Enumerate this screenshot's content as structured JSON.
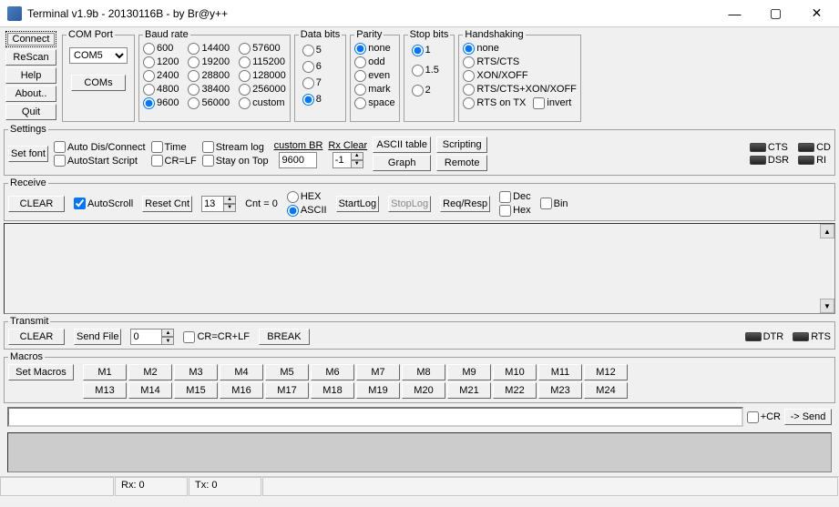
{
  "window": {
    "title": "Terminal v1.9b - 20130116B - by Br@y++"
  },
  "leftButtons": {
    "connect": "Connect",
    "rescan": "ReScan",
    "help": "Help",
    "about": "About..",
    "quit": "Quit"
  },
  "comPort": {
    "legend": "COM Port",
    "selected": "COM5",
    "btn": "COMs"
  },
  "baud": {
    "legend": "Baud rate",
    "options": [
      "600",
      "1200",
      "2400",
      "4800",
      "9600",
      "14400",
      "19200",
      "28800",
      "38400",
      "56000",
      "57600",
      "115200",
      "128000",
      "256000",
      "custom"
    ],
    "selected": "9600"
  },
  "dataBits": {
    "legend": "Data bits",
    "options": [
      "5",
      "6",
      "7",
      "8"
    ],
    "selected": "8"
  },
  "parity": {
    "legend": "Parity",
    "options": [
      "none",
      "odd",
      "even",
      "mark",
      "space"
    ],
    "selected": "none"
  },
  "stopBits": {
    "legend": "Stop bits",
    "options": [
      "1",
      "1.5",
      "2"
    ],
    "selected": "1"
  },
  "handshaking": {
    "legend": "Handshaking",
    "options": [
      "none",
      "RTS/CTS",
      "XON/XOFF",
      "RTS/CTS+XON/XOFF",
      "RTS on TX"
    ],
    "selected": "none",
    "invert": "invert"
  },
  "settings": {
    "legend": "Settings",
    "setFont": "Set font",
    "autoDisConnect": "Auto Dis/Connect",
    "autoStartScript": "AutoStart Script",
    "time": "Time",
    "crlf": "CR=LF",
    "streamLog": "Stream log",
    "stayOnTop": "Stay on Top",
    "customBR": "custom BR",
    "customBRVal": "9600",
    "neg1": "-1",
    "rxClear": "Rx Clear",
    "asciiTable": "ASCII table",
    "graph": "Graph",
    "scripting": "Scripting",
    "remote": "Remote",
    "leds": {
      "cts": "CTS",
      "cd": "CD",
      "dsr": "DSR",
      "ri": "RI"
    }
  },
  "receive": {
    "legend": "Receive",
    "clear": "CLEAR",
    "autoScroll": "AutoScroll",
    "resetCnt": "Reset Cnt",
    "cntVal": "13",
    "cntEq": "Cnt = ",
    "cntNum": "0",
    "hex": "HEX",
    "ascii": "ASCII",
    "startLog": "StartLog",
    "stopLog": "StopLog",
    "reqResp": "Req/Resp",
    "dec": "Dec",
    "hexChk": "Hex",
    "bin": "Bin"
  },
  "transmit": {
    "legend": "Transmit",
    "clear": "CLEAR",
    "sendFile": "Send File",
    "numVal": "0",
    "crcrlf": "CR=CR+LF",
    "break": "BREAK",
    "dtr": "DTR",
    "rts": "RTS"
  },
  "macros": {
    "legend": "Macros",
    "setMacros": "Set Macros",
    "items": [
      "M1",
      "M2",
      "M3",
      "M4",
      "M5",
      "M6",
      "M7",
      "M8",
      "M9",
      "M10",
      "M11",
      "M12",
      "M13",
      "M14",
      "M15",
      "M16",
      "M17",
      "M18",
      "M19",
      "M20",
      "M21",
      "M22",
      "M23",
      "M24"
    ]
  },
  "send": {
    "cr": "+CR",
    "send": "-> Send"
  },
  "status": {
    "rx": "Rx: 0",
    "tx": "Tx: 0"
  }
}
